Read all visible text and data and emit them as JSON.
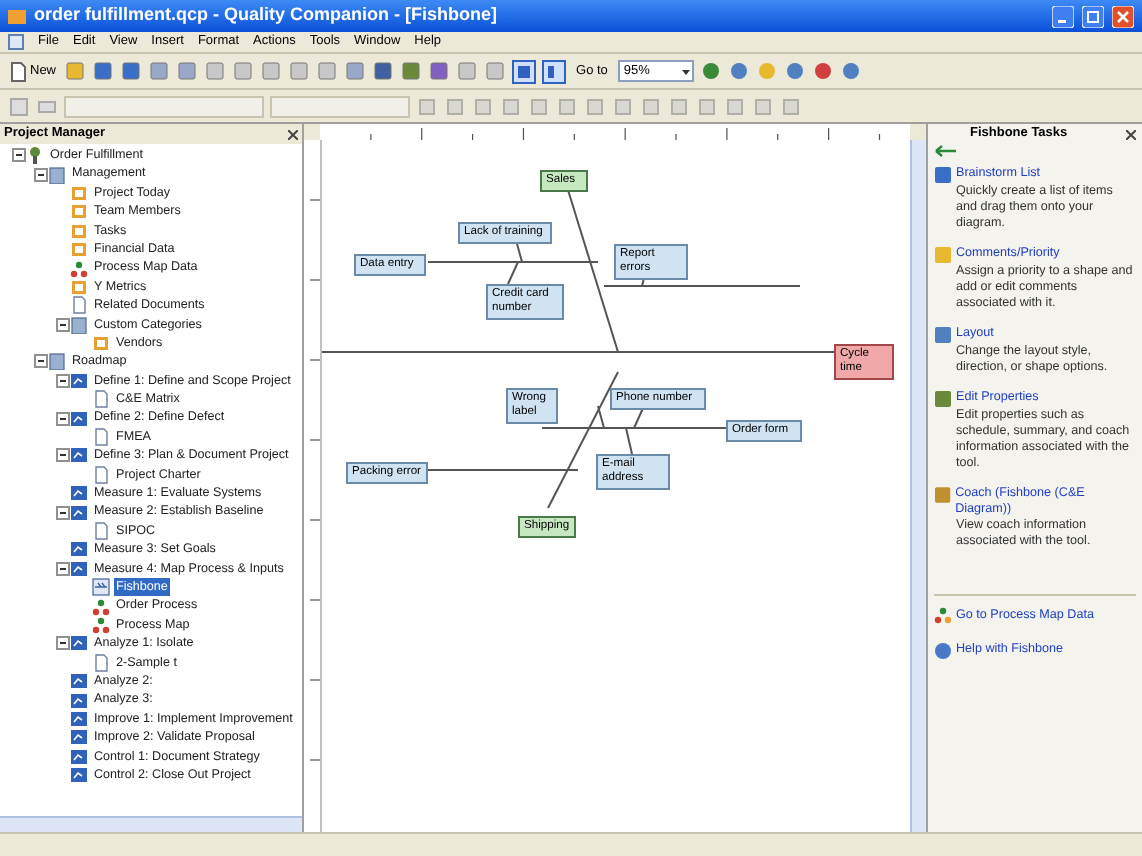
{
  "window": {
    "title": "order fulfillment.qcp - Quality Companion - [Fishbone]"
  },
  "menu": [
    "File",
    "Edit",
    "View",
    "Insert",
    "Format",
    "Actions",
    "Tools",
    "Window",
    "Help"
  ],
  "toolbar": {
    "new_label": "New",
    "goto_label": "Go to",
    "zoom": "95%"
  },
  "project_manager": {
    "title": "Project Manager",
    "tree": [
      {
        "label": "Order Fulfillment",
        "kind": "root",
        "selected": false,
        "children": [
          {
            "label": "Management",
            "kind": "folder",
            "selected": false,
            "children": [
              {
                "label": "Project Today",
                "kind": "page",
                "selected": false
              },
              {
                "label": "Team Members",
                "kind": "page",
                "selected": false
              },
              {
                "label": "Tasks",
                "kind": "page",
                "selected": false
              },
              {
                "label": "Financial Data",
                "kind": "page",
                "selected": false
              },
              {
                "label": "Process Map Data",
                "kind": "map",
                "selected": false
              },
              {
                "label": "Y Metrics",
                "kind": "page",
                "selected": false
              },
              {
                "label": "Related Documents",
                "kind": "doc",
                "selected": false
              },
              {
                "label": "Custom Categories",
                "kind": "folder",
                "selected": false,
                "children": [
                  {
                    "label": "Vendors",
                    "kind": "page",
                    "selected": false
                  }
                ]
              }
            ]
          },
          {
            "label": "Roadmap",
            "kind": "folder",
            "selected": false,
            "children": [
              {
                "label": "Define 1: Define and Scope Project",
                "kind": "phase",
                "selected": false,
                "children": [
                  {
                    "label": "C&E Matrix",
                    "kind": "doc",
                    "selected": false
                  }
                ]
              },
              {
                "label": "Define 2: Define Defect",
                "kind": "phase",
                "selected": false,
                "children": [
                  {
                    "label": "FMEA",
                    "kind": "doc",
                    "selected": false
                  }
                ]
              },
              {
                "label": "Define 3: Plan & Document Project",
                "kind": "phase",
                "selected": false,
                "children": [
                  {
                    "label": "Project Charter",
                    "kind": "doc",
                    "selected": false
                  }
                ]
              },
              {
                "label": "Measure 1: Evaluate Systems",
                "kind": "phase",
                "selected": false
              },
              {
                "label": "Measure 2: Establish Baseline",
                "kind": "phase",
                "selected": false,
                "children": [
                  {
                    "label": "SIPOC",
                    "kind": "doc",
                    "selected": false
                  }
                ]
              },
              {
                "label": "Measure 3: Set Goals",
                "kind": "phase",
                "selected": false
              },
              {
                "label": "Measure 4: Map Process & Inputs",
                "kind": "phase",
                "selected": false,
                "children": [
                  {
                    "label": "Fishbone",
                    "kind": "fishbone",
                    "selected": true
                  },
                  {
                    "label": "Order Process",
                    "kind": "map",
                    "selected": false
                  },
                  {
                    "label": "Process Map",
                    "kind": "map",
                    "selected": false
                  }
                ]
              },
              {
                "label": "Analyze 1: Isolate",
                "kind": "phase",
                "selected": false,
                "children": [
                  {
                    "label": "2-Sample t",
                    "kind": "doc",
                    "selected": false
                  }
                ]
              },
              {
                "label": "Analyze 2:",
                "kind": "phase",
                "selected": false
              },
              {
                "label": "Analyze 3:",
                "kind": "phase",
                "selected": false
              },
              {
                "label": "Improve 1: Implement Improvement",
                "kind": "phase",
                "selected": false
              },
              {
                "label": "Improve 2: Validate Proposal",
                "kind": "phase",
                "selected": false
              },
              {
                "label": "Control 1: Document Strategy",
                "kind": "phase",
                "selected": false
              },
              {
                "label": "Control 2: Close Out Project",
                "kind": "phase",
                "selected": false
              }
            ]
          }
        ]
      }
    ]
  },
  "diagram": {
    "nodes": [
      {
        "text": "Sales",
        "kind": "category"
      },
      {
        "text": "Lack of training",
        "kind": "cause"
      },
      {
        "text": "Data entry",
        "kind": "cause"
      },
      {
        "text": "Credit card number",
        "kind": "cause"
      },
      {
        "text": "Report errors",
        "kind": "cause"
      },
      {
        "text": "Cycle time",
        "kind": "effect"
      },
      {
        "text": "Wrong label",
        "kind": "cause"
      },
      {
        "text": "Phone number",
        "kind": "cause"
      },
      {
        "text": "Order form",
        "kind": "cause"
      },
      {
        "text": "Packing error",
        "kind": "cause"
      },
      {
        "text": "E-mail address",
        "kind": "cause"
      },
      {
        "text": "Shipping",
        "kind": "category"
      }
    ]
  },
  "task_pane": {
    "title": "Fishbone Tasks",
    "tasks": [
      {
        "title": "Brainstorm List",
        "description": "Quickly create a list of items and drag them onto your diagram."
      },
      {
        "title": "Comments/Priority",
        "description": "Assign a priority to a shape and add or edit comments associated with it."
      },
      {
        "title": "Layout",
        "description": "Change the layout style, direction, or shape options."
      },
      {
        "title": "Edit Properties",
        "description": "Edit properties such as schedule, summary, and coach information associated with the tool."
      },
      {
        "title": "Coach (Fishbone (C&E Diagram))",
        "description": "View coach information associated with the tool."
      }
    ],
    "links": [
      "Go to Process Map Data",
      "Help with Fishbone"
    ]
  }
}
